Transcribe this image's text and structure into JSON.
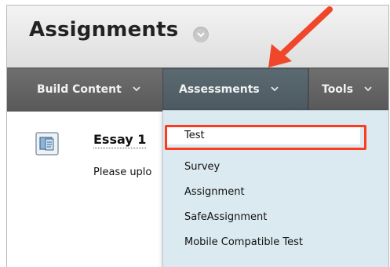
{
  "page": {
    "title": "Assignments"
  },
  "toolbar": {
    "items": [
      {
        "label": "Build Content"
      },
      {
        "label": "Assessments"
      },
      {
        "label": "Tools"
      }
    ]
  },
  "content_item": {
    "title": "Essay 1",
    "description": "Please uplo"
  },
  "dropdown": {
    "items": [
      {
        "label": "Test",
        "highlighted": true
      },
      {
        "label": "Survey"
      },
      {
        "label": "Assignment"
      },
      {
        "label": "SafeAssignment"
      },
      {
        "label": "Mobile Compatible Test"
      }
    ]
  },
  "colors": {
    "highlight_border": "#ff3b1f",
    "arrow": "#f0472b",
    "dropdown_bg": "#dbeaf0",
    "toolbar_bg": "#636363"
  },
  "icons": {
    "title_menu": "chevron-down-icon",
    "toolbar_menu": "chevron-down-icon",
    "content_item": "document-icon",
    "callout": "arrow-icon"
  }
}
